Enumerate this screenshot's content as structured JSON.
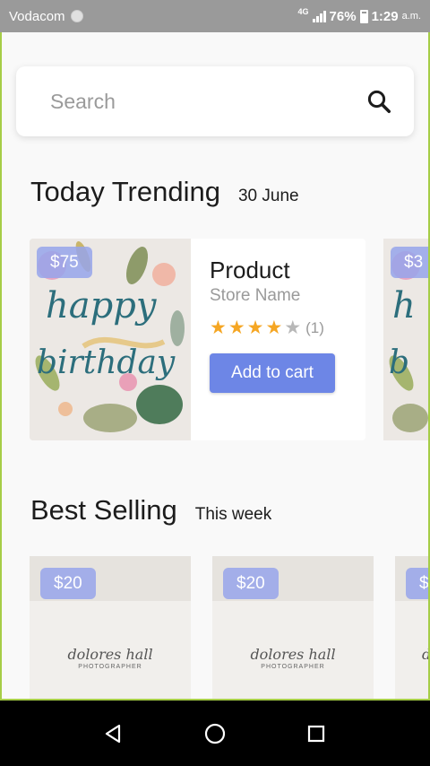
{
  "status": {
    "carrier": "Vodacom",
    "network": "4G",
    "battery": "76%",
    "time": "1:29",
    "ampm": "a.m."
  },
  "search": {
    "placeholder": "Search"
  },
  "trending": {
    "title": "Today Trending",
    "date": "30 June",
    "card": {
      "price": "$75",
      "name": "Product",
      "store": "Store Name",
      "rating": 4,
      "rating_max": 5,
      "count": "(1)",
      "button": "Add to cart",
      "art_text": [
        "happy",
        "birthday"
      ]
    },
    "peek_price": "$3"
  },
  "best": {
    "title": "Best Selling",
    "period": "This week",
    "cards": [
      {
        "price": "$20",
        "art_line1": "dolores hall",
        "art_line2": "PHOTOGRAPHER"
      },
      {
        "price": "$20",
        "art_line1": "dolores hall",
        "art_line2": "PHOTOGRAPHER"
      },
      {
        "price": "$",
        "art_line1": "d",
        "art_line2": ""
      }
    ]
  },
  "colors": {
    "accent": "#6d86e6",
    "star": "#f5a623",
    "frame": "#a6cd47"
  },
  "icons": {
    "search": "search-icon",
    "back": "back-icon",
    "home": "home-icon",
    "recents": "recents-icon"
  }
}
